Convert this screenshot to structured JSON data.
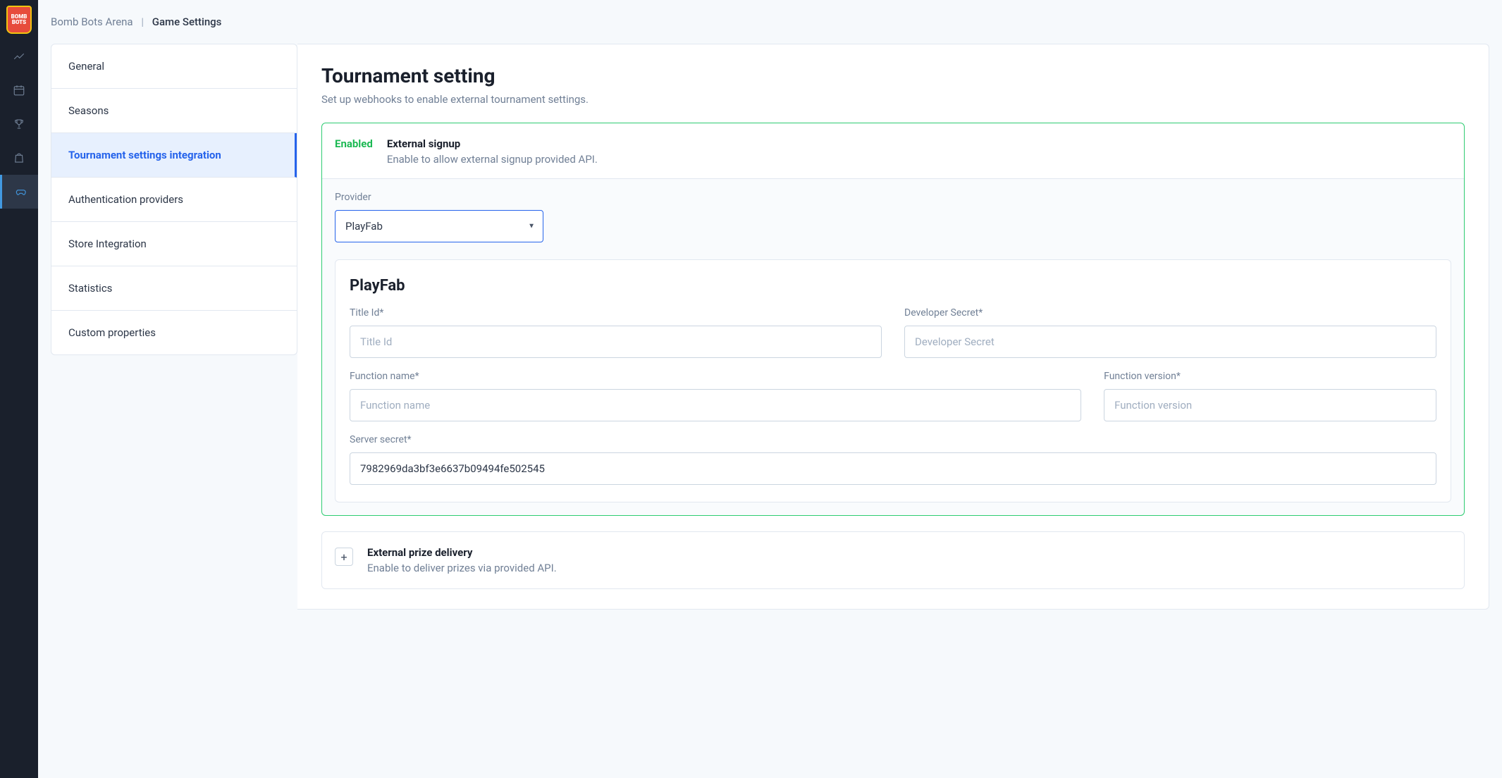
{
  "logo_text": "BOMB BOTS",
  "breadcrumb": {
    "root": "Bomb Bots Arena",
    "sep": "|",
    "current": "Game Settings"
  },
  "nav_rail": [
    "analytics",
    "calendar",
    "trophy",
    "shopping",
    "game"
  ],
  "side_menu": [
    {
      "label": "General"
    },
    {
      "label": "Seasons"
    },
    {
      "label": "Tournament settings integration",
      "active": true
    },
    {
      "label": "Authentication providers"
    },
    {
      "label": "Store Integration"
    },
    {
      "label": "Statistics"
    },
    {
      "label": "Custom properties"
    }
  ],
  "page": {
    "title": "Tournament setting",
    "subtitle": "Set up webhooks to enable external tournament settings."
  },
  "signup_card": {
    "status": "Enabled",
    "title": "External signup",
    "desc": "Enable to allow external signup provided API."
  },
  "provider": {
    "label": "Provider",
    "selected": "PlayFab",
    "options": [
      "PlayFab"
    ]
  },
  "playfab": {
    "heading": "PlayFab",
    "title_id": {
      "label": "Title Id*",
      "placeholder": "Title Id",
      "value": ""
    },
    "dev_secret": {
      "label": "Developer Secret*",
      "placeholder": "Developer Secret",
      "value": ""
    },
    "fn_name": {
      "label": "Function name*",
      "placeholder": "Function name",
      "value": ""
    },
    "fn_version": {
      "label": "Function version*",
      "placeholder": "Function version",
      "value": ""
    },
    "server_secret": {
      "label": "Server secret*",
      "value": "7982969da3bf3e6637b09494fe502545"
    }
  },
  "prize_card": {
    "title": "External prize delivery",
    "desc": "Enable to deliver prizes via provided API.",
    "btn": "+"
  }
}
